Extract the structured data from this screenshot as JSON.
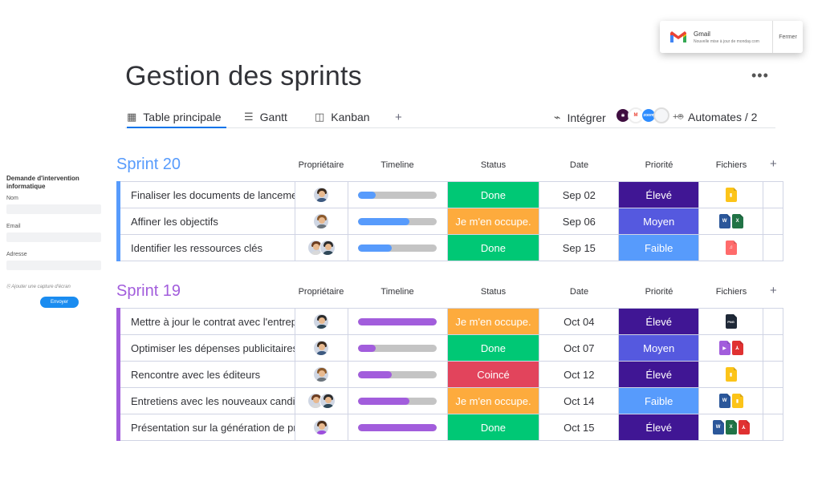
{
  "notification": {
    "app": "Gmail",
    "message": "Nouvelle mise à jour de monday.com",
    "close_label": "Fermer"
  },
  "side_form": {
    "title": "Demande d'intervention informatique",
    "fields": [
      {
        "label": "Nom"
      },
      {
        "label": "Email"
      },
      {
        "label": "Adresse"
      }
    ],
    "attach_label": "Ajouter une capture d'écran",
    "submit_label": "Envoyer"
  },
  "header": {
    "title": "Gestion des sprints",
    "more_label": "•••",
    "tabs": [
      {
        "label": "Table principale",
        "icon": "table-icon",
        "active": true
      },
      {
        "label": "Gantt",
        "icon": "gantt-icon",
        "active": false
      },
      {
        "label": "Kanban",
        "icon": "kanban-icon",
        "active": false
      }
    ],
    "add_tab": "+",
    "integrate_label": "Intégrer",
    "apps": [
      {
        "name": "slack",
        "color": "#3f0e40",
        "text": "✱"
      },
      {
        "name": "gmail",
        "color": "#ffffff",
        "text": "M"
      },
      {
        "name": "zoom",
        "color": "#2d8cff",
        "text": "zoom"
      },
      {
        "name": "more",
        "color": "#f5f6f8",
        "text": ""
      }
    ],
    "automates_prefix": "+",
    "automates_label": "Automates / 2"
  },
  "columns": {
    "owner": "Propriétaire",
    "timeline": "Timeline",
    "status": "Status",
    "date": "Date",
    "priority": "Priorité",
    "files": "Fichiers",
    "add": "+"
  },
  "colors": {
    "done": "#00c875",
    "working": "#fdab3d",
    "stuck": "#e2445c",
    "high": "#401694",
    "medium": "#5559df",
    "low": "#579bfc",
    "sprint20": "#579bfc",
    "sprint19": "#a25ddc"
  },
  "groups": [
    {
      "title": "Sprint 20",
      "color": "#579bfc",
      "rows": [
        {
          "task": "Finaliser les documents de lancement",
          "owners": 1,
          "timeline": 0.22,
          "status": "Done",
          "status_color": "#00c875",
          "date": "Sep 02",
          "priority": "Élevé",
          "priority_color": "#401694",
          "files": [
            "zip"
          ]
        },
        {
          "task": "Affiner les objectifs",
          "owners": 1,
          "timeline": 0.65,
          "status": "Je m'en occupe.",
          "status_color": "#fdab3d",
          "date": "Sep 06",
          "priority": "Moyen",
          "priority_color": "#5559df",
          "files": [
            "word",
            "excel"
          ]
        },
        {
          "task": "Identifier les ressources clés",
          "owners": 2,
          "timeline": 0.43,
          "status": "Done",
          "status_color": "#00c875",
          "date": "Sep 15",
          "priority": "Faible",
          "priority_color": "#579bfc",
          "files": [
            "audio"
          ]
        }
      ]
    },
    {
      "title": "Sprint 19",
      "color": "#a25ddc",
      "rows": [
        {
          "task": "Mettre à jour le contrat avec l'entreprise",
          "owners": 1,
          "timeline": 1.0,
          "status": "Je m'en occupe.",
          "status_color": "#fdab3d",
          "date": "Oct 04",
          "priority": "Élevé",
          "priority_color": "#401694",
          "files": [
            "png"
          ]
        },
        {
          "task": "Optimiser les dépenses publicitaires",
          "owners": 1,
          "timeline": 0.22,
          "status": "Done",
          "status_color": "#00c875",
          "date": "Oct 07",
          "priority": "Moyen",
          "priority_color": "#5559df",
          "files": [
            "video",
            "pdf"
          ]
        },
        {
          "task": "Rencontre avec les éditeurs",
          "owners": 1,
          "timeline": 0.43,
          "status": "Coincé",
          "status_color": "#e2445c",
          "date": "Oct 12",
          "priority": "Élevé",
          "priority_color": "#401694",
          "files": [
            "zip"
          ]
        },
        {
          "task": "Entretiens avec les nouveaux candidats",
          "owners": 2,
          "timeline": 0.65,
          "status": "Je m'en occupe.",
          "status_color": "#fdab3d",
          "date": "Oct 14",
          "priority": "Faible",
          "priority_color": "#579bfc",
          "files": [
            "word",
            "zip"
          ]
        },
        {
          "task": "Présentation sur la génération de prospects",
          "owners": 1,
          "timeline": 1.0,
          "status": "Done",
          "status_color": "#00c875",
          "date": "Oct 15",
          "priority": "Élevé",
          "priority_color": "#401694",
          "files": [
            "word",
            "excel",
            "pdf"
          ]
        }
      ]
    }
  ]
}
